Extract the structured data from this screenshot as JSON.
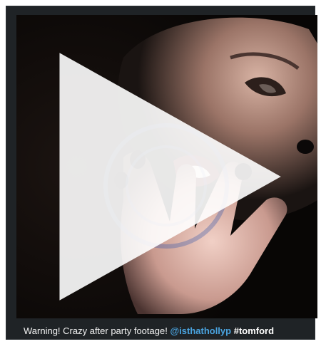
{
  "post": {
    "caption_text": "Warning! Crazy after party footage!",
    "mention": "@isthathollyp",
    "hashtag": "#tomford",
    "media_type": "video",
    "play_icon": "play-icon"
  },
  "colors": {
    "card_background": "#1f2326",
    "mention": "#4aa3df",
    "caption_text": "#f2f2f2"
  }
}
